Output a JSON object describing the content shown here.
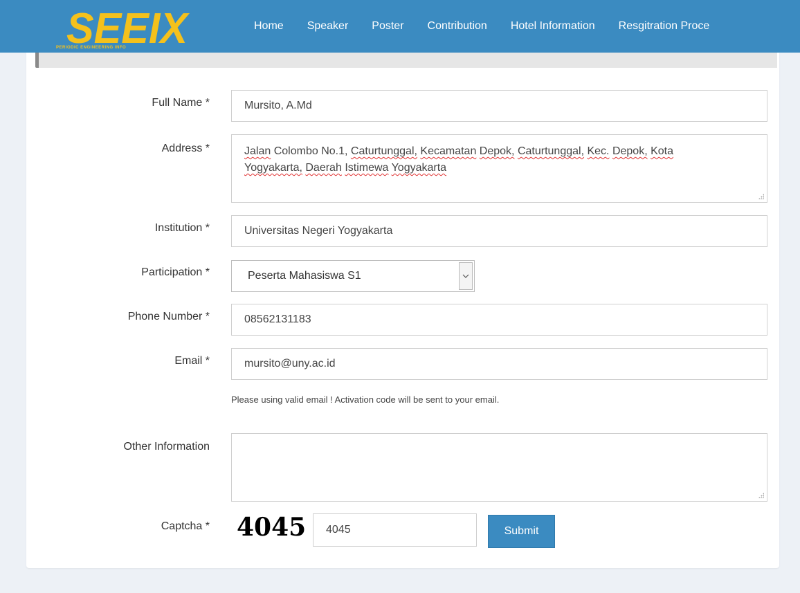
{
  "brand": {
    "logo_text": "SEEIX",
    "logo_tagline": "PERIODIC ENGINEERING INFO",
    "colors": {
      "navbar": "#3b8bc1",
      "logo": "#f4c11c",
      "button": "#3b8bc1"
    }
  },
  "nav": {
    "items": [
      {
        "label": "Home"
      },
      {
        "label": "Speaker"
      },
      {
        "label": "Poster"
      },
      {
        "label": "Contribution"
      },
      {
        "label": "Hotel Information"
      },
      {
        "label": "Resgitration Proce"
      }
    ]
  },
  "form": {
    "full_name": {
      "label": "Full Name *",
      "value": "Mursito, A.Md"
    },
    "address": {
      "label": "Address *",
      "words_line1": [
        "Jalan",
        "Colombo",
        "No.1,",
        "Caturtunggal,",
        "Kecamatan",
        "Depok,",
        "Caturtunggal,",
        "Kec.",
        "Depok,",
        "Kota"
      ],
      "words_line2": [
        "Yogyakarta,",
        "Daerah",
        "Istimewa",
        "Yogyakarta"
      ]
    },
    "institution": {
      "label": "Institution *",
      "value": "Universitas Negeri Yogyakarta"
    },
    "participation": {
      "label": "Participation *",
      "value": "Peserta Mahasiswa S1"
    },
    "phone": {
      "label": "Phone Number *",
      "value": "08562131183"
    },
    "email": {
      "label": "Email *",
      "value": "mursito@uny.ac.id",
      "help": "Please using valid email ! Activation code will be sent to your email."
    },
    "other": {
      "label": "Other Information",
      "value": ""
    },
    "captcha": {
      "label": "Captcha *",
      "image_text": "4045",
      "value": "4045"
    },
    "submit_label": "Submit"
  }
}
